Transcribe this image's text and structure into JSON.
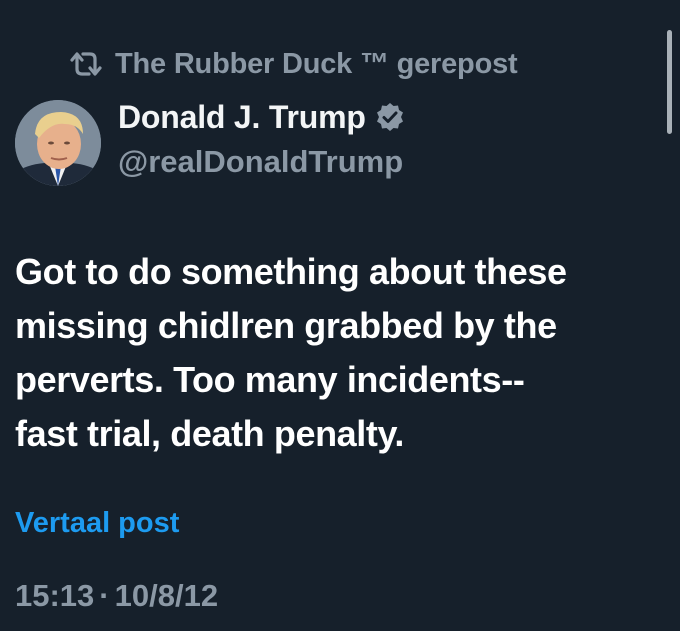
{
  "repost": {
    "icon": "repost-icon",
    "text": "The Rubber Duck ™ gerepost"
  },
  "author": {
    "name": "Donald J. Trump",
    "handle": "@realDonaldTrump",
    "verified_icon": "verified-badge-icon"
  },
  "post": {
    "lines": [
      "Got to do something about these",
      "missing chidlren grabbed by the",
      "perverts. Too many incidents--",
      "fast trial, death penalty."
    ]
  },
  "translate_label": "Vertaal post",
  "meta": {
    "time": "15:13",
    "separator": "·",
    "date": "10/8/12"
  },
  "colors": {
    "background": "#16202b",
    "primary_text": "#ffffff",
    "secondary_text": "#8b98a5",
    "link": "#1d9bf0",
    "verified_badge": "#8b98a5"
  }
}
